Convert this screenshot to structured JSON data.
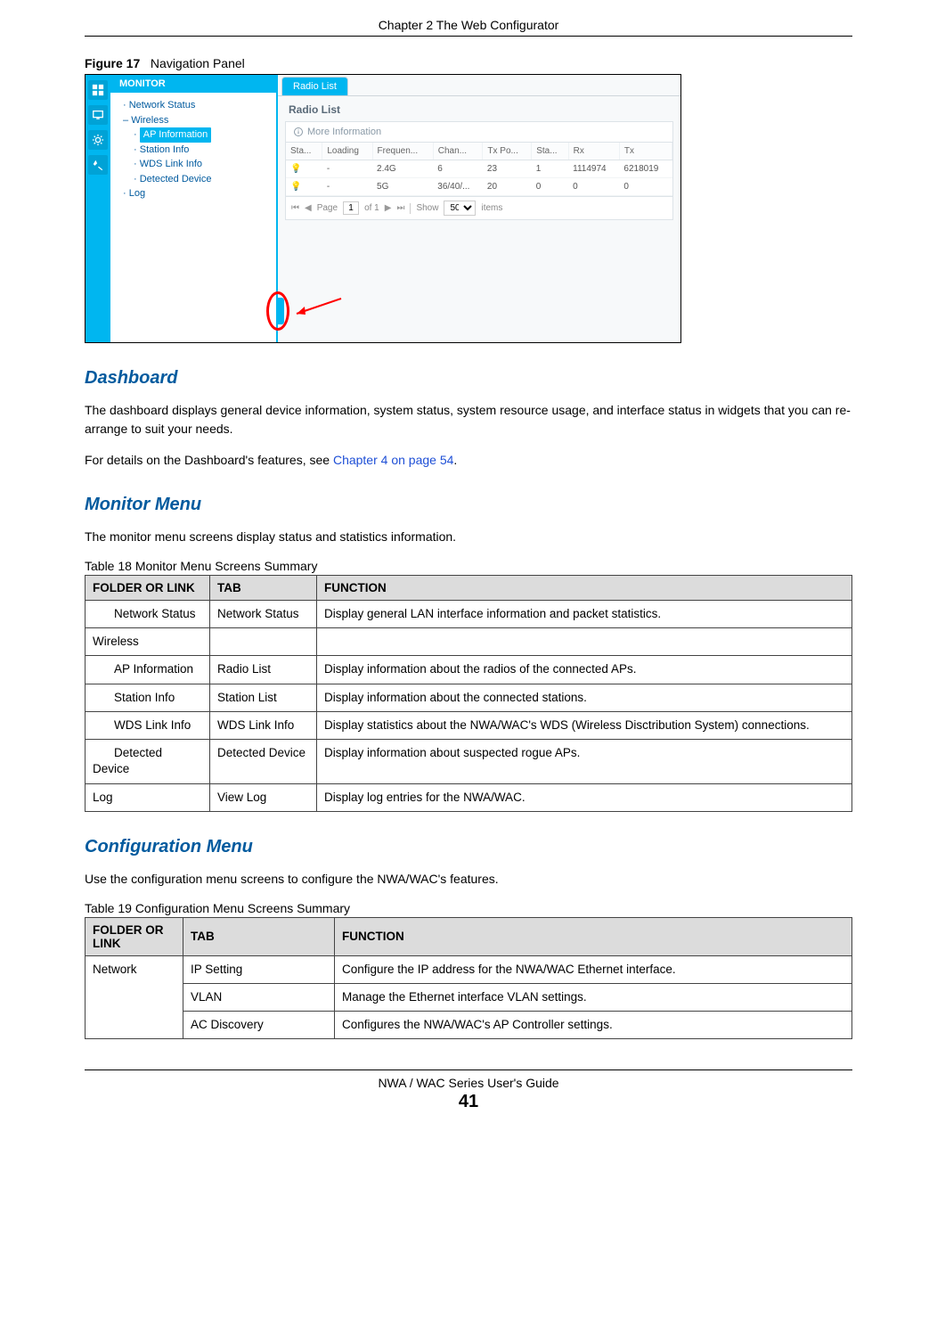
{
  "page": {
    "chapter_header": "Chapter 2 The Web Configurator",
    "footer_title": "NWA / WAC Series User's Guide",
    "footer_page": "41"
  },
  "figure": {
    "label": "Figure 17",
    "title": "Navigation Panel"
  },
  "screenshot": {
    "monitor_label": "MONITOR",
    "tree": {
      "network_status": "Network Status",
      "wireless": "Wireless",
      "ap_information": "AP Information",
      "station_info": "Station Info",
      "wds_link_info": "WDS Link Info",
      "detected_device": "Detected Device",
      "log": "Log"
    },
    "tab_label": "Radio List",
    "panel_title": "Radio List",
    "more_info": "More Information",
    "grid": {
      "headers": [
        "Sta...",
        "Loading",
        "Frequen...",
        "Chan...",
        "Tx Po...",
        "Sta...",
        "Rx",
        "Tx"
      ],
      "rows": [
        {
          "loading": "-",
          "freq": "2.4G",
          "chan": "6",
          "txpo": "23",
          "sta": "1",
          "rx": "1114974",
          "tx": "6218019"
        },
        {
          "loading": "-",
          "freq": "5G",
          "chan": "36/40/...",
          "txpo": "20",
          "sta": "0",
          "rx": "0",
          "tx": "0"
        }
      ]
    },
    "paging": {
      "page_label": "Page",
      "page_value": "1",
      "of_label": "of 1",
      "show_label": "Show",
      "show_value": "50",
      "items_label": "items"
    }
  },
  "sections": {
    "dashboard": {
      "heading": "Dashboard",
      "p1": "The dashboard displays general device information, system status, system resource usage, and interface status in widgets that you can re-arrange to suit your needs.",
      "p2_prefix": "For details on the Dashboard's features, see ",
      "p2_link": "Chapter 4 on page 54",
      "p2_suffix": "."
    },
    "monitor": {
      "heading": "Monitor Menu",
      "p1": "The monitor menu screens display status and statistics information."
    },
    "config": {
      "heading": "Configuration Menu",
      "p1": "Use the configuration menu screens to configure the NWA/WAC's features."
    }
  },
  "table18": {
    "caption": "Table 18   Monitor Menu Screens Summary",
    "headers": {
      "c1": "FOLDER OR LINK",
      "c2": "TAB",
      "c3": "FUNCTION"
    },
    "rows": [
      {
        "c1": "Network Status",
        "c1_indent": true,
        "c2": "Network Status",
        "c3": "Display general LAN interface information and packet statistics."
      },
      {
        "c1": "Wireless",
        "c1_indent": false,
        "c2": "",
        "c3": ""
      },
      {
        "c1": "AP Information",
        "c1_indent": true,
        "c2": "Radio List",
        "c3": "Display information about the radios of the connected APs."
      },
      {
        "c1": "Station Info",
        "c1_indent": true,
        "c2": "Station List",
        "c3": "Display information about the connected stations."
      },
      {
        "c1": "WDS Link Info",
        "c1_indent": true,
        "c2": "WDS Link Info",
        "c3": "Display statistics about the NWA/WAC's WDS (Wireless Disctribution System) connections."
      },
      {
        "c1": "Detected Device",
        "c1_indent": true,
        "c2": "Detected Device",
        "c3": "Display information about suspected rogue APs."
      },
      {
        "c1": "Log",
        "c1_indent": false,
        "c2": "View Log",
        "c3": "Display log entries for the NWA/WAC."
      }
    ]
  },
  "table19": {
    "caption": "Table 19   Configuration Menu Screens Summary",
    "headers": {
      "c1": "FOLDER OR LINK",
      "c2": "TAB",
      "c3": "FUNCTION"
    },
    "network_label": "Network",
    "rows": [
      {
        "c2": "IP Setting",
        "c3": "Configure the IP address for the NWA/WAC Ethernet interface."
      },
      {
        "c2": "VLAN",
        "c3": "Manage the Ethernet interface VLAN settings."
      },
      {
        "c2": "AC Discovery",
        "c3": "Configures the NWA/WAC's AP Controller settings."
      }
    ]
  }
}
